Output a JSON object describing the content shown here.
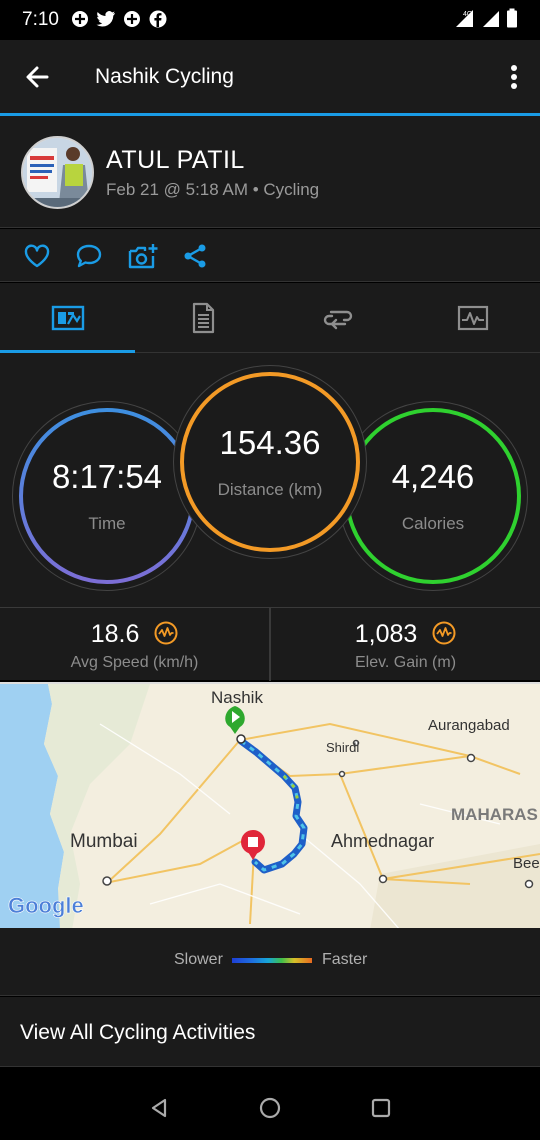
{
  "status_bar": {
    "time": "7:10",
    "network_label": "4G"
  },
  "app_bar": {
    "title": "Nashik Cycling",
    "icons": [
      "back-arrow-icon",
      "more-vert-icon"
    ]
  },
  "activity": {
    "user_name": "ATUL PATIL",
    "meta": "Feb 21 @ 5:18 AM • Cycling"
  },
  "actions": [
    "like-heart-icon",
    "comment-icon",
    "add-photo-icon",
    "share-icon"
  ],
  "tabs": [
    {
      "name": "overview",
      "icon": "overview-chart-icon",
      "selected": true
    },
    {
      "name": "details",
      "icon": "document-icon",
      "selected": false
    },
    {
      "name": "laps",
      "icon": "laps-loop-icon",
      "selected": false
    },
    {
      "name": "charts",
      "icon": "activity-chart-icon",
      "selected": false
    }
  ],
  "stats": {
    "time": {
      "value": "8:17:54",
      "label": "Time"
    },
    "distance": {
      "value": "154.36",
      "label": "Distance (km)"
    },
    "calories": {
      "value": "4,246",
      "label": "Calories"
    }
  },
  "summary": {
    "avg_speed": {
      "value": "18.6",
      "label": "Avg Speed (km/h)"
    },
    "elev_gain": {
      "value": "1,083",
      "label": "Elev. Gain (m)"
    }
  },
  "map": {
    "labels": {
      "nashik": "Nashik",
      "aurangabad": "Aurangabad",
      "shirdi": "Shirdi",
      "maharashtra": "MAHARAS",
      "mumbai": "Mumbai",
      "ahmednagar": "Ahmednagar",
      "beed": "Bee"
    },
    "google_logo": "Google"
  },
  "legend": {
    "slower": "Slower",
    "faster": "Faster"
  },
  "view_all": {
    "label": "View All Cycling Activities"
  },
  "colors": {
    "accent": "#1a9ce6",
    "time_ring": "#4a90e2",
    "distance_ring": "#f39a26",
    "calories_ring": "#2fd12f",
    "wave_icon": "#f39a26"
  }
}
